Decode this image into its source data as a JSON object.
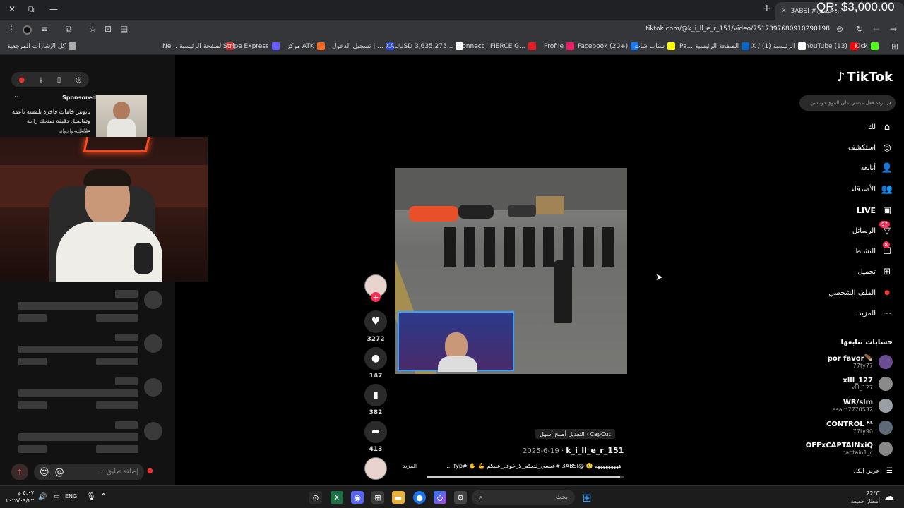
{
  "overlay": {
    "qr_text": "QR: $3,000.00"
  },
  "browser": {
    "url": "tiktok.com/@k_i_ll_e_r_151/video/7517397680910290198",
    "tab_title": "3ABSI #عبسي ...",
    "new_tab_icon": "+",
    "bookmarks": [
      {
        "label": "كل الإشارات المرجعية",
        "color": "#aaaaaa"
      },
      {
        "label": "Ne... الصفحة الرئيسية",
        "color": "#c4302b"
      },
      {
        "label": "Stripe Express",
        "color": "#635bff"
      },
      {
        "label": "مركز ATK",
        "color": "#f26b21"
      },
      {
        "label": "تسجيل الدخول | ...",
        "color": "#2a4bd7"
      },
      {
        "label": "XAUUSD 3,635.275...",
        "color": "#ffffff"
      },
      {
        "label": "Connect | FIERCE G...",
        "color": "#e31b23"
      },
      {
        "label": "Profile",
        "color": "#e91e63"
      },
      {
        "label": "Facebook (20+)",
        "color": "#1877f2"
      },
      {
        "label": "سناب شات",
        "color": "#fffc00"
      },
      {
        "label": "Pa... الصفحة الرئيسية",
        "color": "#0a66c2"
      },
      {
        "label": "X / الرئيسية (1)",
        "color": "#ffffff"
      },
      {
        "label": "YouTube (13)",
        "color": "#ff0000"
      },
      {
        "label": "Kick",
        "color": "#53fc18"
      }
    ]
  },
  "left_panel": {
    "sponsored_label": "Sponsored",
    "ad_text": "بايونير خامات فاخرة بلمسة ناعمة وتفاصيل دقيقة تمنحك راحة مثالي...",
    "ad_brand": "عبدالله واخوانه",
    "comment_placeholder": "إضافة تعليق...",
    "mention_icon": "@"
  },
  "tiktok": {
    "logo": "TikTok",
    "search_placeholder": "ردة فعل عبسي على القوي دونيشن",
    "nav": [
      {
        "label": "لك",
        "icon": "home-icon",
        "glyph": "⌂"
      },
      {
        "label": "استكشف",
        "icon": "compass-icon",
        "glyph": "◎"
      },
      {
        "label": "أتابعه",
        "icon": "following-icon",
        "glyph": "👤"
      },
      {
        "label": "الأصدقاء",
        "icon": "friends-icon",
        "glyph": "👥"
      },
      {
        "label": "LIVE",
        "icon": "live-icon",
        "glyph": "▣"
      },
      {
        "label": "الرسائل",
        "icon": "messages-icon",
        "glyph": "▽",
        "badge": "97"
      },
      {
        "label": "النشاط",
        "icon": "activity-icon",
        "glyph": "☐",
        "badge": "8"
      },
      {
        "label": "تحميل",
        "icon": "upload-icon",
        "glyph": "⊞"
      },
      {
        "label": "الملف الشخصي",
        "icon": "profile-icon",
        "glyph": "●"
      },
      {
        "label": "المزيد",
        "icon": "more-icon",
        "glyph": "⋯"
      }
    ],
    "following_title": "حسابات تتابعها",
    "following": [
      {
        "name": "por favor🪶",
        "handle": "77ty77",
        "color": "#6a4c93"
      },
      {
        "name": "xlll_127",
        "handle": "xlll_127",
        "color": "#8a8a8a"
      },
      {
        "name": "WR/slm",
        "handle": "asam7770532",
        "color": "#9aa0a6"
      },
      {
        "name": "CONTROL ᴷᴸ",
        "handle": "77ty90",
        "color": "#5f6a78"
      },
      {
        "name": "OFFxCAPTAINxiQ",
        "handle": "captain1_c",
        "color": "#888888"
      }
    ],
    "see_all": "عرض الكل",
    "actions": [
      {
        "icon": "heart-icon",
        "glyph": "♥",
        "count": "3272"
      },
      {
        "icon": "comment-icon",
        "glyph": "●",
        "count": "147"
      },
      {
        "icon": "bookmark-icon",
        "glyph": "▮",
        "count": "382"
      },
      {
        "icon": "share-icon",
        "glyph": "➦",
        "count": "413"
      }
    ],
    "capcut_label": "CapCut · التعديل أصبح أسهل",
    "author": "k_i_ll_e_r_151",
    "date": "2025-6-19",
    "caption": "هههههههههه 🥲 @3ABSI #عبسي_لديكم_لا_خوف_عليكم 💪 ✋ #fyp ...",
    "more_label": "المزيد"
  },
  "taskbar": {
    "time": "٥:٠٧ م",
    "date": "٢٠٢٥/٠٩/٢٣",
    "lang": "ENG",
    "search_placeholder": "بحث",
    "weather_temp": "22°C",
    "weather_desc": "أمطار خفيفة"
  }
}
